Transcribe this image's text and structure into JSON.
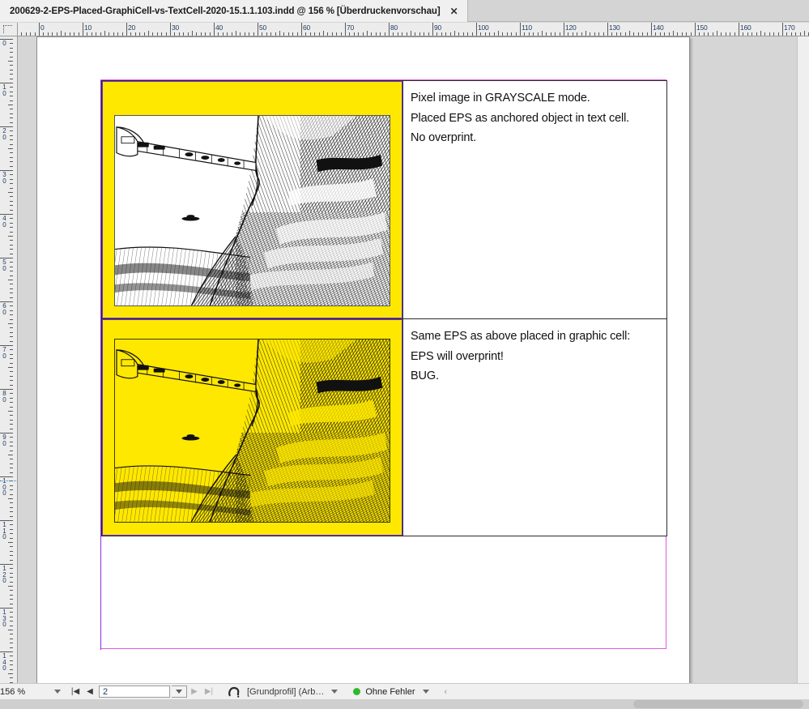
{
  "window": {
    "tab_title": "200629-2-EPS-Placed-GraphiCell-vs-TextCell-2020-15.1.1.103.indd @  156 % [Überdruckenvorschau]",
    "close_glyph": "✕"
  },
  "rulers": {
    "horizontal_labels": [
      "0",
      "10",
      "20",
      "30",
      "40",
      "50",
      "60",
      "70",
      "80",
      "90",
      "100",
      "110",
      "120",
      "130",
      "140",
      "150",
      "160",
      "170"
    ],
    "vertical_labels": [
      "0",
      "10",
      "20",
      "30",
      "40",
      "50",
      "60",
      "70",
      "80",
      "90",
      "100",
      "110",
      "120",
      "130",
      "140"
    ],
    "unit_step": 10,
    "pixels_per_step": 54
  },
  "document": {
    "table": {
      "rows": [
        {
          "graphic_cell": {
            "name": "grayscale-eps-cell",
            "background_color": "#ffe800",
            "artwork_background": "#ffffff",
            "artwork_caption": "pen-and-ink canyon landscape with bridge"
          },
          "text_cell": {
            "lines": [
              "Pixel image in GRAYSCALE mode.",
              "Placed EPS as anchored object in text cell.",
              "No overprint."
            ]
          }
        },
        {
          "graphic_cell": {
            "name": "overprinted-eps-cell",
            "background_color": "#ffe800",
            "artwork_background": "#ffe800",
            "artwork_caption": "same pen-and-ink canyon landscape overprinted on yellow"
          },
          "text_cell": {
            "lines": [
              "Same EPS as above placed in graphic cell:",
              "EPS will overprint!",
              "BUG."
            ]
          }
        }
      ]
    },
    "frame_colors": {
      "text_frame": "#e05ae0",
      "anchored_object_frame": "#8a2be2",
      "table_border": "#2b2b2b"
    }
  },
  "statusbar": {
    "zoom_level": "156 %",
    "first_page_glyph": "|◀",
    "prev_page_glyph": "◀",
    "page_number": "2",
    "next_page_glyph": "▶",
    "last_page_glyph": "▶|",
    "preflight_profile": "[Grundprofil] (Arb…",
    "error_status": "Ohne Fehler",
    "error_dot_color": "#2fb82f",
    "overflow_glyph": "‹"
  }
}
